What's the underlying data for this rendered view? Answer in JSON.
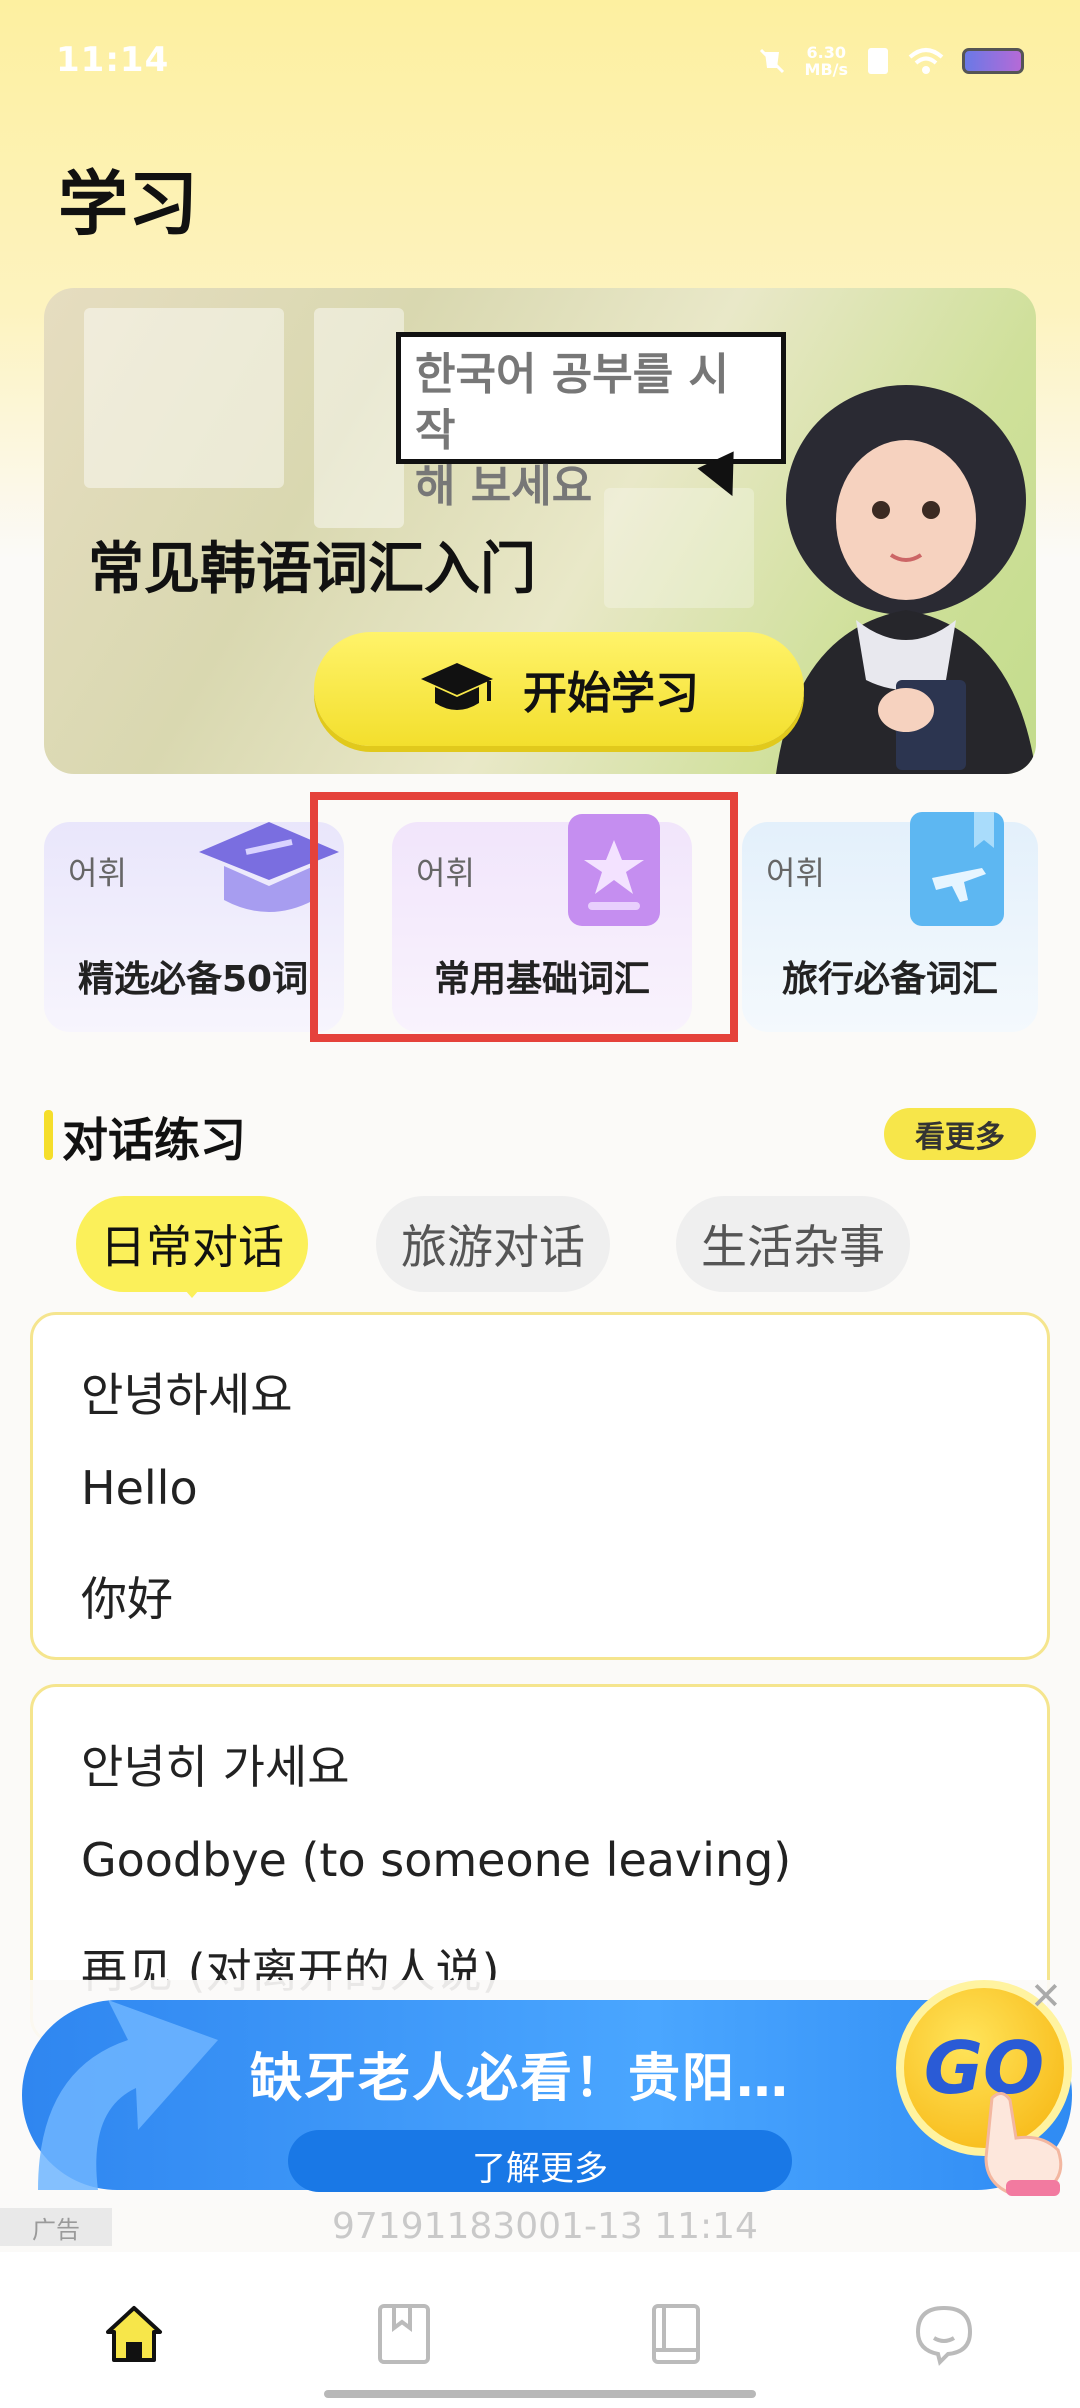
{
  "status_bar": {
    "time": "11:14",
    "speed_value": "6.30",
    "speed_unit": "MB/s"
  },
  "page": {
    "title": "学习"
  },
  "hero": {
    "bubble_line1": "한국어 공부를 시작",
    "bubble_line2": "해 보세요",
    "title": "常见韩语词汇入门",
    "start_button": "开始学习"
  },
  "categories": [
    {
      "tag": "어휘",
      "name": "精选必备50词"
    },
    {
      "tag": "어휘",
      "name": "常用基础词汇"
    },
    {
      "tag": "어휘",
      "name": "旅行必备词汇"
    }
  ],
  "dialogue": {
    "section_title": "对话练习",
    "more_label": "看更多",
    "tabs": [
      "日常对话",
      "旅游对话",
      "生活杂事"
    ],
    "active_tab": "日常对话",
    "cards": [
      {
        "korean": "안녕하세요",
        "english": "Hello",
        "chinese": "你好"
      },
      {
        "korean": "안녕히 가세요",
        "english": "Goodbye (to someone leaving)",
        "chinese": "再见 (对离开的人说)"
      }
    ]
  },
  "ad": {
    "headline": "缺牙老人必看！贵阳…",
    "learn_more": "了解更多",
    "go_label": "GO",
    "badge": "广告",
    "footer": "97191183001-13 11:14"
  },
  "nav": {
    "items": [
      "home-icon",
      "bookmark-icon",
      "book-icon",
      "chat-icon"
    ]
  },
  "colors": {
    "accent_yellow": "#f7e64a",
    "highlight_red": "#e5423b",
    "ad_blue": "#2f86f0"
  }
}
